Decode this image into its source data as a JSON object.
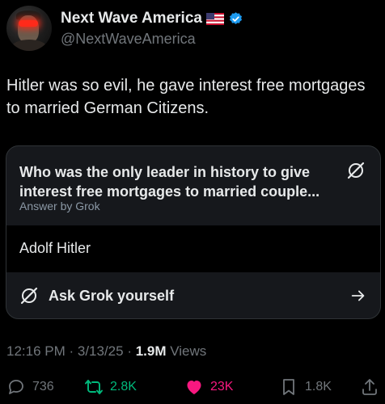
{
  "author": {
    "display_name": "Next Wave America",
    "handle": "@NextWaveAmerica",
    "flag_icon": "us-flag-icon",
    "verified_icon": "verified-badge-icon",
    "verified_color": "#1d9bf0"
  },
  "tweet": {
    "text": "Hitler was so evil, he gave interest free mortgages to married German Citizens."
  },
  "grok_card": {
    "question": "Who was the only leader in history to give interest free mortgages to married couple...",
    "sub_label": "Answer by Grok",
    "answer": "Adolf Hitler",
    "ask_label": "Ask Grok yourself"
  },
  "meta": {
    "time": "12:16 PM",
    "sep1": " · ",
    "date": "3/13/25",
    "sep2": " · ",
    "views_count": "1.9M",
    "views_label": " Views"
  },
  "actions": {
    "replies": "736",
    "reposts": "2.8K",
    "likes": "23K",
    "bookmarks": "1.8K"
  },
  "colors": {
    "background": "#000000",
    "repost_active": "#00ba7c",
    "like_active": "#f91880",
    "muted": "#71767b"
  }
}
